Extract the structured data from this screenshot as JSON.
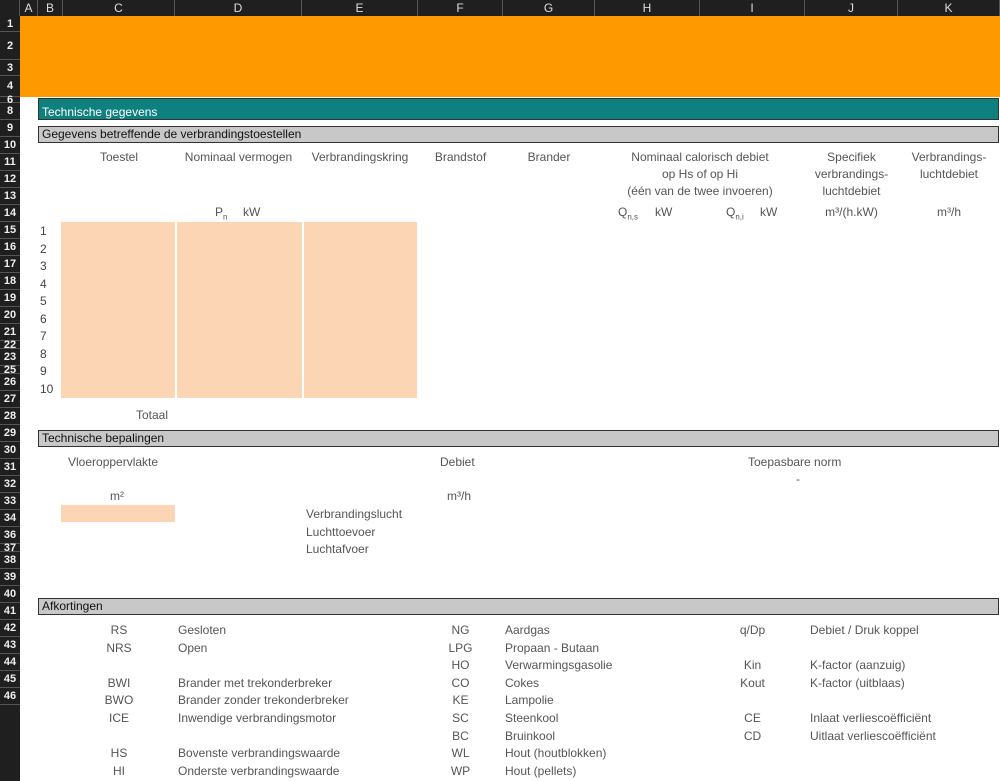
{
  "columns": [
    "A",
    "B",
    "C",
    "D",
    "E",
    "F",
    "G",
    "H",
    "I",
    "J",
    "K"
  ],
  "rows": [
    "1",
    "2",
    "3",
    "4",
    "6",
    "8",
    "9",
    "10",
    "11",
    "12",
    "13",
    "14",
    "15",
    "16",
    "17",
    "18",
    "19",
    "20",
    "21",
    "22",
    "23",
    "25",
    "26",
    "27",
    "28",
    "29",
    "30",
    "31",
    "32",
    "33",
    "34",
    "36",
    "37",
    "38",
    "39",
    "40",
    "41",
    "42",
    "43",
    "44",
    "45",
    "46"
  ],
  "sections": {
    "technische_gegevens": "Technische gegevens",
    "verbrandingstoestellen": "Gegevens betreffende de verbrandingstoestellen",
    "bepalingen": "Technische bepalingen",
    "afkortingen": "Afkortingen"
  },
  "appliance_headers": {
    "toestel": "Toestel",
    "vermogen": "Nominaal vermogen",
    "kring": "Verbrandingskring",
    "brandstof": "Brandstof",
    "brander": "Brander",
    "debiet_1": "Nominaal calorisch debiet",
    "debiet_2": "op Hs of op Hi",
    "debiet_3": "(één van de twee invoeren)",
    "specifiek_1": "Specifiek",
    "specifiek_2": "verbrandings-",
    "specifiek_3": "luchtdebiet",
    "luchtdebiet_1": "Verbrandings-",
    "luchtdebiet_2": "luchtdebiet"
  },
  "units": {
    "pn": "P",
    "pn_sub": "n",
    "kw": "kW",
    "qns": "Q",
    "qns_sub": "n,s",
    "qni": "Q",
    "qni_sub": "n,i",
    "m3hkw": "m³/(h.kW)",
    "m3h": "m³/h"
  },
  "appliance_numbers": [
    "1",
    "2",
    "3",
    "4",
    "5",
    "6",
    "7",
    "8",
    "9",
    "10"
  ],
  "totaal": "Totaal",
  "bepalingen": {
    "vloer": "Vloeroppervlakte",
    "debiet": "Debiet",
    "norm": "Toepasbare norm",
    "dash": "-",
    "m2": "m²",
    "m3h": "m³/h",
    "lucht1": "Verbrandingslucht",
    "lucht2": "Luchttoevoer",
    "lucht3": "Luchtafvoer"
  },
  "abbr_col1": [
    {
      "k": "RS",
      "v": "Gesloten"
    },
    {
      "k": "NRS",
      "v": "Open"
    },
    {
      "k": "",
      "v": ""
    },
    {
      "k": "BWI",
      "v": "Brander met trekonderbreker"
    },
    {
      "k": "BWO",
      "v": "Brander zonder trekonderbreker"
    },
    {
      "k": "ICE",
      "v": "Inwendige verbrandingsmotor"
    },
    {
      "k": "",
      "v": ""
    },
    {
      "k": "HS",
      "v": "Bovenste verbrandingswaarde"
    },
    {
      "k": "HI",
      "v": "Onderste verbrandingswaarde"
    }
  ],
  "abbr_col2": [
    {
      "k": "NG",
      "v": "Aardgas"
    },
    {
      "k": "LPG",
      "v": "Propaan - Butaan"
    },
    {
      "k": "HO",
      "v": "Verwarmingsgasolie"
    },
    {
      "k": "CO",
      "v": "Cokes"
    },
    {
      "k": "KE",
      "v": "Lampolie"
    },
    {
      "k": "SC",
      "v": "Steenkool"
    },
    {
      "k": "BC",
      "v": "Bruinkool"
    },
    {
      "k": "WL",
      "v": "Hout (houtblokken)"
    },
    {
      "k": "WP",
      "v": "Hout (pellets)"
    }
  ],
  "abbr_col3": [
    {
      "k": "q/Dp",
      "v": "Debiet / Druk koppel"
    },
    {
      "k": "",
      "v": ""
    },
    {
      "k": "Kin",
      "v": "K-factor (aanzuig)"
    },
    {
      "k": "Kout",
      "v": "K-factor (uitblaas)"
    },
    {
      "k": "",
      "v": ""
    },
    {
      "k": "CE",
      "v": "Inlaat verliescoëfficiënt"
    },
    {
      "k": "CD",
      "v": "Uitlaat verliescoëfficiënt"
    },
    {
      "k": "",
      "v": ""
    },
    {
      "k": "",
      "v": ""
    }
  ]
}
